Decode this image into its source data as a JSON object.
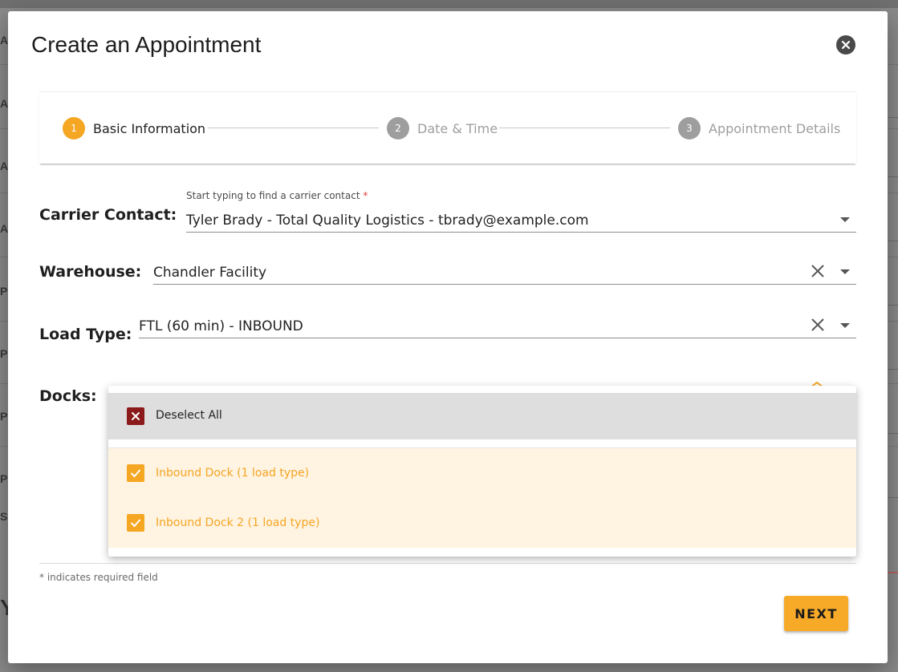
{
  "modal": {
    "title": "Create an Appointment"
  },
  "stepper": {
    "steps": [
      {
        "number": "1",
        "label": "Basic Information",
        "state": "active"
      },
      {
        "number": "2",
        "label": "Date & Time",
        "state": "inactive"
      },
      {
        "number": "3",
        "label": "Appointment Details",
        "state": "inactive"
      }
    ]
  },
  "form": {
    "carrier_contact": {
      "label": "Carrier Contact:",
      "hint": "Start typing to find a carrier contact",
      "required_mark": "*",
      "value": "Tyler Brady - Total Quality Logistics - tbrady@example.com"
    },
    "warehouse": {
      "label": "Warehouse:",
      "value": "Chandler Facility"
    },
    "load_type": {
      "label": "Load Type:",
      "value": "FTL (60 min) - INBOUND"
    },
    "docks": {
      "label": "Docks:",
      "menu": {
        "deselect_label": "Deselect All",
        "options": [
          {
            "label": "Inbound Dock (1 load type)",
            "checked": true
          },
          {
            "label": "Inbound Dock 2 (1 load type)",
            "checked": true
          }
        ]
      }
    }
  },
  "footer": {
    "required_note": "* indicates required field",
    "next_label": "NEXT"
  },
  "colors": {
    "accent": "#f5a623",
    "deselect_box": "#8b1a1a",
    "inactive_step": "#9e9e9e",
    "selected_row_bg": "#fff3e2"
  },
  "icons": {
    "close": "close-circle-icon",
    "dropdown": "caret-down-icon",
    "clear": "clear-x-icon",
    "checked": "checkbox-checked-icon",
    "deselect": "checkbox-x-icon"
  },
  "backdrop": {
    "edge_letters": [
      "A",
      "A",
      "A",
      "A",
      "P",
      "P",
      "P",
      "P",
      "S",
      "Y"
    ]
  }
}
